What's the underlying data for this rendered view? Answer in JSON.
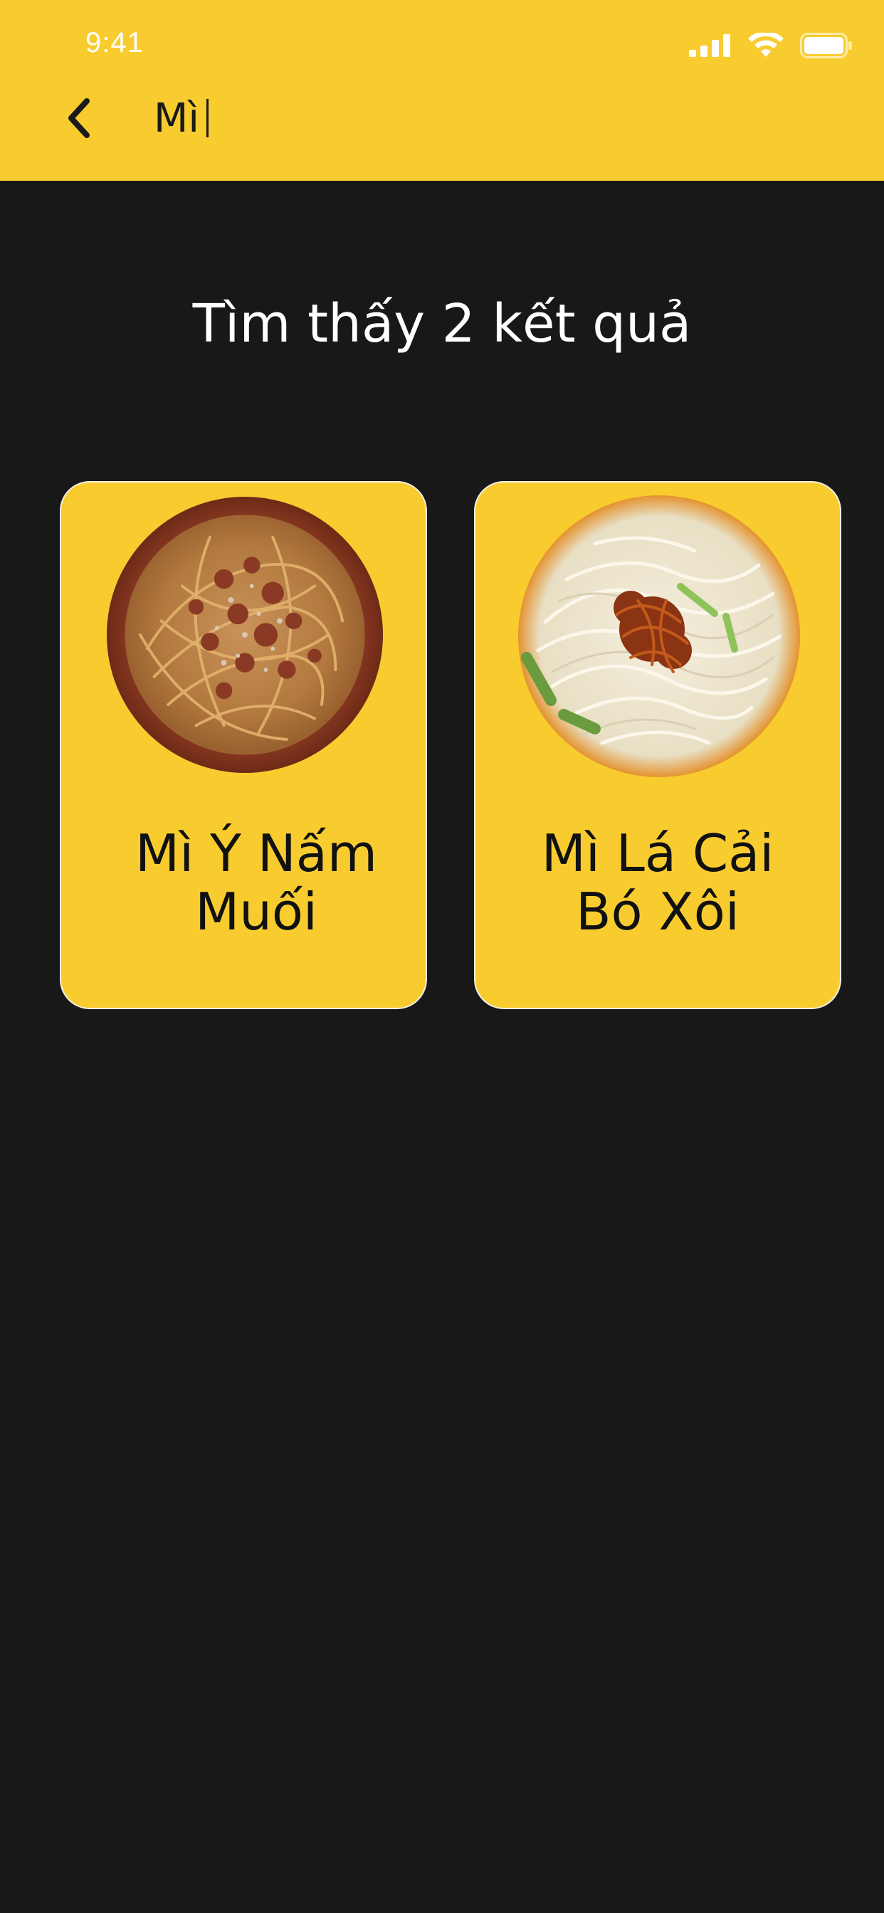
{
  "status_bar": {
    "time": "9:41"
  },
  "header": {
    "search_value": "Mì"
  },
  "results": {
    "title": "Tìm thấy 2 kết quả",
    "items": [
      {
        "name": "Mì Ý Nấm\nMuối",
        "photo": "spaghetti-bolognese-bowl"
      },
      {
        "name": "Mì Lá Cải\nBó Xôi",
        "photo": "noodle-soup-bowl"
      }
    ]
  },
  "colors": {
    "header_bg": "#F8CC2F",
    "page_bg": "#181818",
    "card_bg": "#F8CC2F",
    "card_border": "#F3F0E6"
  }
}
